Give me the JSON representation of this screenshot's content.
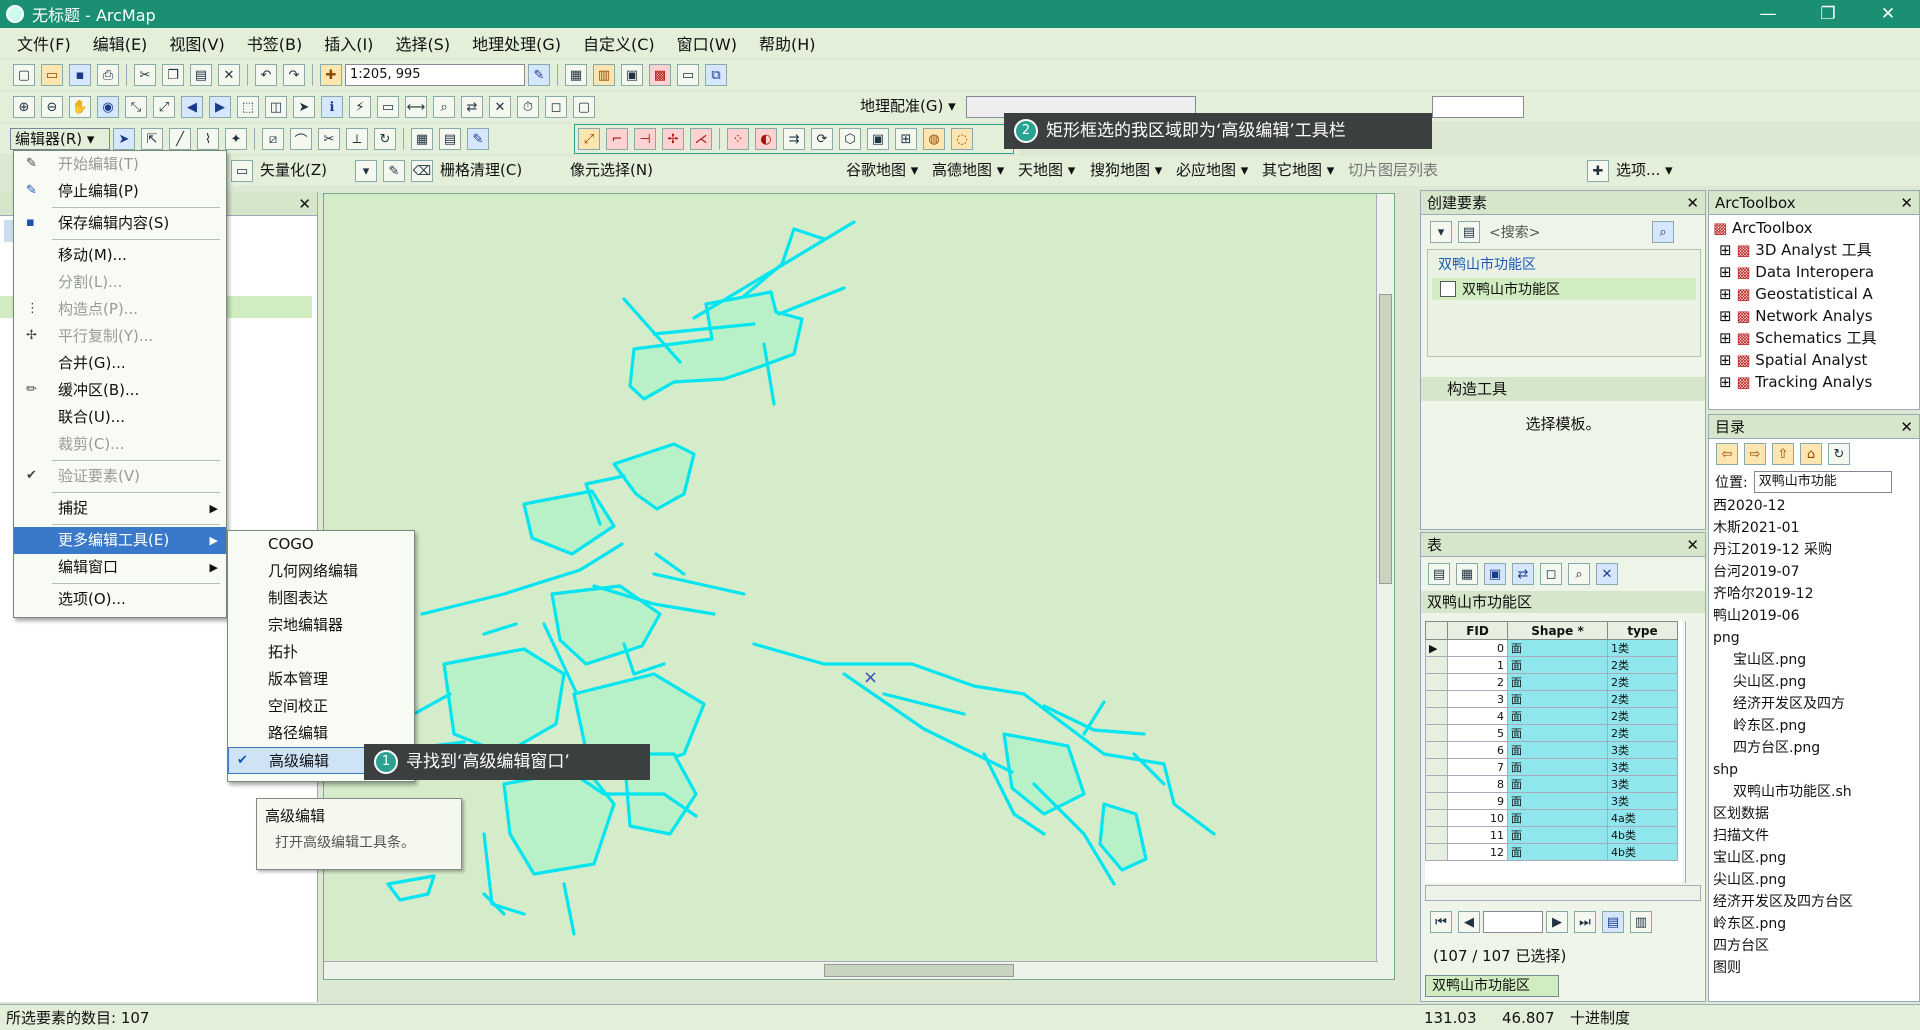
{
  "window": {
    "title": "无标题 - ArcMap",
    "minimize": "—",
    "maximize": "❐",
    "close": "✕"
  },
  "menubar": [
    "文件(F)",
    "编辑(E)",
    "视图(V)",
    "书签(B)",
    "插入(I)",
    "选择(S)",
    "地理处理(G)",
    "自定义(C)",
    "窗口(W)",
    "帮助(H)"
  ],
  "toolbar": {
    "scale": "1:205, 995",
    "geoproc_label": "地理配准(G) ▾",
    "editor_label": "编辑器(R) ▾",
    "vectorize_label": "矢量化(Z)",
    "raster_clean_label": "栅格清理(C)",
    "cell_select_label": "像元选择(N)",
    "google_map": "谷歌地图 ▾",
    "gaode_map": "高德地图 ▾",
    "tianditu": "天地图 ▾",
    "sogou_map": "搜狗地图 ▾",
    "bing_map": "必应地图 ▾",
    "other_map": "其它地图 ▾",
    "tile_layers": "切片图层列表",
    "options": "选项... ▾"
  },
  "editor_menu": {
    "items": [
      {
        "label": "开始编辑(T)",
        "disabled": true,
        "icon": "pencil-icon"
      },
      {
        "label": "停止编辑(P)",
        "disabled": false,
        "icon": "pencil-stop-icon"
      },
      {
        "label": "保存编辑内容(S)",
        "disabled": false,
        "icon": "save-icon"
      },
      {
        "label": "移动(M)...",
        "disabled": false,
        "icon": ""
      },
      {
        "label": "分割(L)...",
        "disabled": true,
        "icon": ""
      },
      {
        "label": "构造点(P)...",
        "disabled": true,
        "icon": "construct-points-icon"
      },
      {
        "label": "平行复制(Y)...",
        "disabled": true,
        "icon": "parallel-copy-icon"
      },
      {
        "label": "合并(G)...",
        "disabled": false,
        "icon": ""
      },
      {
        "label": "缓冲区(B)...",
        "disabled": false,
        "icon": "buffer-icon"
      },
      {
        "label": "联合(U)...",
        "disabled": false,
        "icon": ""
      },
      {
        "label": "裁剪(C)...",
        "disabled": true,
        "icon": ""
      },
      {
        "label": "验证要素(V)",
        "disabled": true,
        "icon": "validate-icon"
      },
      {
        "label": "捕捉",
        "disabled": false,
        "icon": "",
        "submenu": true
      },
      {
        "label": "更多编辑工具(E)",
        "disabled": false,
        "icon": "",
        "submenu": true,
        "highlight": true
      },
      {
        "label": "编辑窗口",
        "disabled": false,
        "icon": "",
        "submenu": true
      },
      {
        "label": "选项(O)...",
        "disabled": false,
        "icon": ""
      }
    ]
  },
  "more_tools_menu": [
    "COGO",
    "几何网络编辑",
    "制图表达",
    "宗地编辑器",
    "拓扑",
    "版本管理",
    "空间校正",
    "路径编辑",
    "高级编辑"
  ],
  "tooltip": {
    "title": "高级编辑",
    "desc": "打开高级编辑工具条。"
  },
  "callouts": [
    {
      "num": "1",
      "text": "寻找到‘高级编辑窗口’"
    },
    {
      "num": "2",
      "text": "矩形框选的我区域即为‘高级编辑’工具栏"
    }
  ],
  "create_features": {
    "title": "创建要素",
    "search_placeholder": "<搜索>",
    "group": "双鸭山市功能区",
    "layer": "双鸭山市功能区",
    "construct_title": "构造工具",
    "select_template": "选择模板。"
  },
  "table": {
    "title": "表",
    "layer_tab": "双鸭山市功能区",
    "headers": [
      "FID",
      "Shape *",
      "type"
    ],
    "rows": [
      [
        "0",
        "面",
        "1类"
      ],
      [
        "1",
        "面",
        "2类"
      ],
      [
        "2",
        "面",
        "2类"
      ],
      [
        "3",
        "面",
        "2类"
      ],
      [
        "4",
        "面",
        "2类"
      ],
      [
        "5",
        "面",
        "2类"
      ],
      [
        "6",
        "面",
        "3类"
      ],
      [
        "7",
        "面",
        "3类"
      ],
      [
        "8",
        "面",
        "3类"
      ],
      [
        "9",
        "面",
        "3类"
      ],
      [
        "10",
        "面",
        "4a类"
      ],
      [
        "11",
        "面",
        "4b类"
      ],
      [
        "12",
        "面",
        "4b类"
      ]
    ],
    "selection": "(107 / 107 已选择)",
    "bottom_tab": "双鸭山市功能区"
  },
  "arctoolbox": {
    "title": "ArcToolbox",
    "root": "ArcToolbox",
    "items": [
      "3D Analyst 工具",
      "Data Interopera",
      "Geostatistical A",
      "Network Analys",
      "Schematics 工具",
      "Spatial Analyst",
      "Tracking Analys"
    ]
  },
  "catalog": {
    "title": "目录",
    "location_label": "位置:",
    "location_value": "双鸭山市功能",
    "items": [
      "西2020-12",
      "木斯2021-01",
      "丹江2019-12 采购",
      "台河2019-07",
      "齐哈尔2019-12",
      "鸭山2019-06",
      "png",
      "宝山区.png",
      "尖山区.png",
      "经济开发区及四方",
      "岭东区.png",
      "四方台区.png",
      "shp",
      "双鸭山市功能区.sh",
      "区划数据",
      "扫描文件",
      "宝山区.png",
      "尖山区.png",
      "经济开发区及四方台区",
      "岭东区.png",
      "四方台区",
      "图则"
    ]
  },
  "status": {
    "left": "所选要素的数目: 107",
    "x": "131.03",
    "y": "46.807",
    "unit": "十进制度"
  },
  "colors": {
    "feature": "#00e5ef",
    "map_bg": "#d5eccb",
    "feature_fill": "#b8f0c8"
  }
}
